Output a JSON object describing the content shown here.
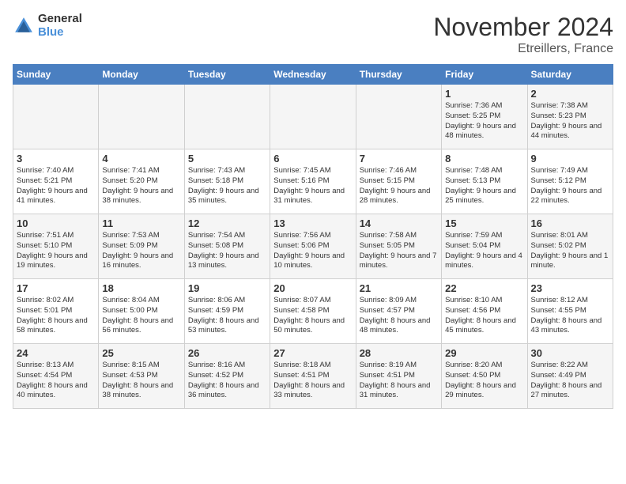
{
  "header": {
    "logo_general": "General",
    "logo_blue": "Blue",
    "month_title": "November 2024",
    "location": "Etreillers, France"
  },
  "days_of_week": [
    "Sunday",
    "Monday",
    "Tuesday",
    "Wednesday",
    "Thursday",
    "Friday",
    "Saturday"
  ],
  "weeks": [
    [
      {
        "day": "",
        "info": ""
      },
      {
        "day": "",
        "info": ""
      },
      {
        "day": "",
        "info": ""
      },
      {
        "day": "",
        "info": ""
      },
      {
        "day": "",
        "info": ""
      },
      {
        "day": "1",
        "info": "Sunrise: 7:36 AM\nSunset: 5:25 PM\nDaylight: 9 hours and 48 minutes."
      },
      {
        "day": "2",
        "info": "Sunrise: 7:38 AM\nSunset: 5:23 PM\nDaylight: 9 hours and 44 minutes."
      }
    ],
    [
      {
        "day": "3",
        "info": "Sunrise: 7:40 AM\nSunset: 5:21 PM\nDaylight: 9 hours and 41 minutes."
      },
      {
        "day": "4",
        "info": "Sunrise: 7:41 AM\nSunset: 5:20 PM\nDaylight: 9 hours and 38 minutes."
      },
      {
        "day": "5",
        "info": "Sunrise: 7:43 AM\nSunset: 5:18 PM\nDaylight: 9 hours and 35 minutes."
      },
      {
        "day": "6",
        "info": "Sunrise: 7:45 AM\nSunset: 5:16 PM\nDaylight: 9 hours and 31 minutes."
      },
      {
        "day": "7",
        "info": "Sunrise: 7:46 AM\nSunset: 5:15 PM\nDaylight: 9 hours and 28 minutes."
      },
      {
        "day": "8",
        "info": "Sunrise: 7:48 AM\nSunset: 5:13 PM\nDaylight: 9 hours and 25 minutes."
      },
      {
        "day": "9",
        "info": "Sunrise: 7:49 AM\nSunset: 5:12 PM\nDaylight: 9 hours and 22 minutes."
      }
    ],
    [
      {
        "day": "10",
        "info": "Sunrise: 7:51 AM\nSunset: 5:10 PM\nDaylight: 9 hours and 19 minutes."
      },
      {
        "day": "11",
        "info": "Sunrise: 7:53 AM\nSunset: 5:09 PM\nDaylight: 9 hours and 16 minutes."
      },
      {
        "day": "12",
        "info": "Sunrise: 7:54 AM\nSunset: 5:08 PM\nDaylight: 9 hours and 13 minutes."
      },
      {
        "day": "13",
        "info": "Sunrise: 7:56 AM\nSunset: 5:06 PM\nDaylight: 9 hours and 10 minutes."
      },
      {
        "day": "14",
        "info": "Sunrise: 7:58 AM\nSunset: 5:05 PM\nDaylight: 9 hours and 7 minutes."
      },
      {
        "day": "15",
        "info": "Sunrise: 7:59 AM\nSunset: 5:04 PM\nDaylight: 9 hours and 4 minutes."
      },
      {
        "day": "16",
        "info": "Sunrise: 8:01 AM\nSunset: 5:02 PM\nDaylight: 9 hours and 1 minute."
      }
    ],
    [
      {
        "day": "17",
        "info": "Sunrise: 8:02 AM\nSunset: 5:01 PM\nDaylight: 8 hours and 58 minutes."
      },
      {
        "day": "18",
        "info": "Sunrise: 8:04 AM\nSunset: 5:00 PM\nDaylight: 8 hours and 56 minutes."
      },
      {
        "day": "19",
        "info": "Sunrise: 8:06 AM\nSunset: 4:59 PM\nDaylight: 8 hours and 53 minutes."
      },
      {
        "day": "20",
        "info": "Sunrise: 8:07 AM\nSunset: 4:58 PM\nDaylight: 8 hours and 50 minutes."
      },
      {
        "day": "21",
        "info": "Sunrise: 8:09 AM\nSunset: 4:57 PM\nDaylight: 8 hours and 48 minutes."
      },
      {
        "day": "22",
        "info": "Sunrise: 8:10 AM\nSunset: 4:56 PM\nDaylight: 8 hours and 45 minutes."
      },
      {
        "day": "23",
        "info": "Sunrise: 8:12 AM\nSunset: 4:55 PM\nDaylight: 8 hours and 43 minutes."
      }
    ],
    [
      {
        "day": "24",
        "info": "Sunrise: 8:13 AM\nSunset: 4:54 PM\nDaylight: 8 hours and 40 minutes."
      },
      {
        "day": "25",
        "info": "Sunrise: 8:15 AM\nSunset: 4:53 PM\nDaylight: 8 hours and 38 minutes."
      },
      {
        "day": "26",
        "info": "Sunrise: 8:16 AM\nSunset: 4:52 PM\nDaylight: 8 hours and 36 minutes."
      },
      {
        "day": "27",
        "info": "Sunrise: 8:18 AM\nSunset: 4:51 PM\nDaylight: 8 hours and 33 minutes."
      },
      {
        "day": "28",
        "info": "Sunrise: 8:19 AM\nSunset: 4:51 PM\nDaylight: 8 hours and 31 minutes."
      },
      {
        "day": "29",
        "info": "Sunrise: 8:20 AM\nSunset: 4:50 PM\nDaylight: 8 hours and 29 minutes."
      },
      {
        "day": "30",
        "info": "Sunrise: 8:22 AM\nSunset: 4:49 PM\nDaylight: 8 hours and 27 minutes."
      }
    ]
  ]
}
